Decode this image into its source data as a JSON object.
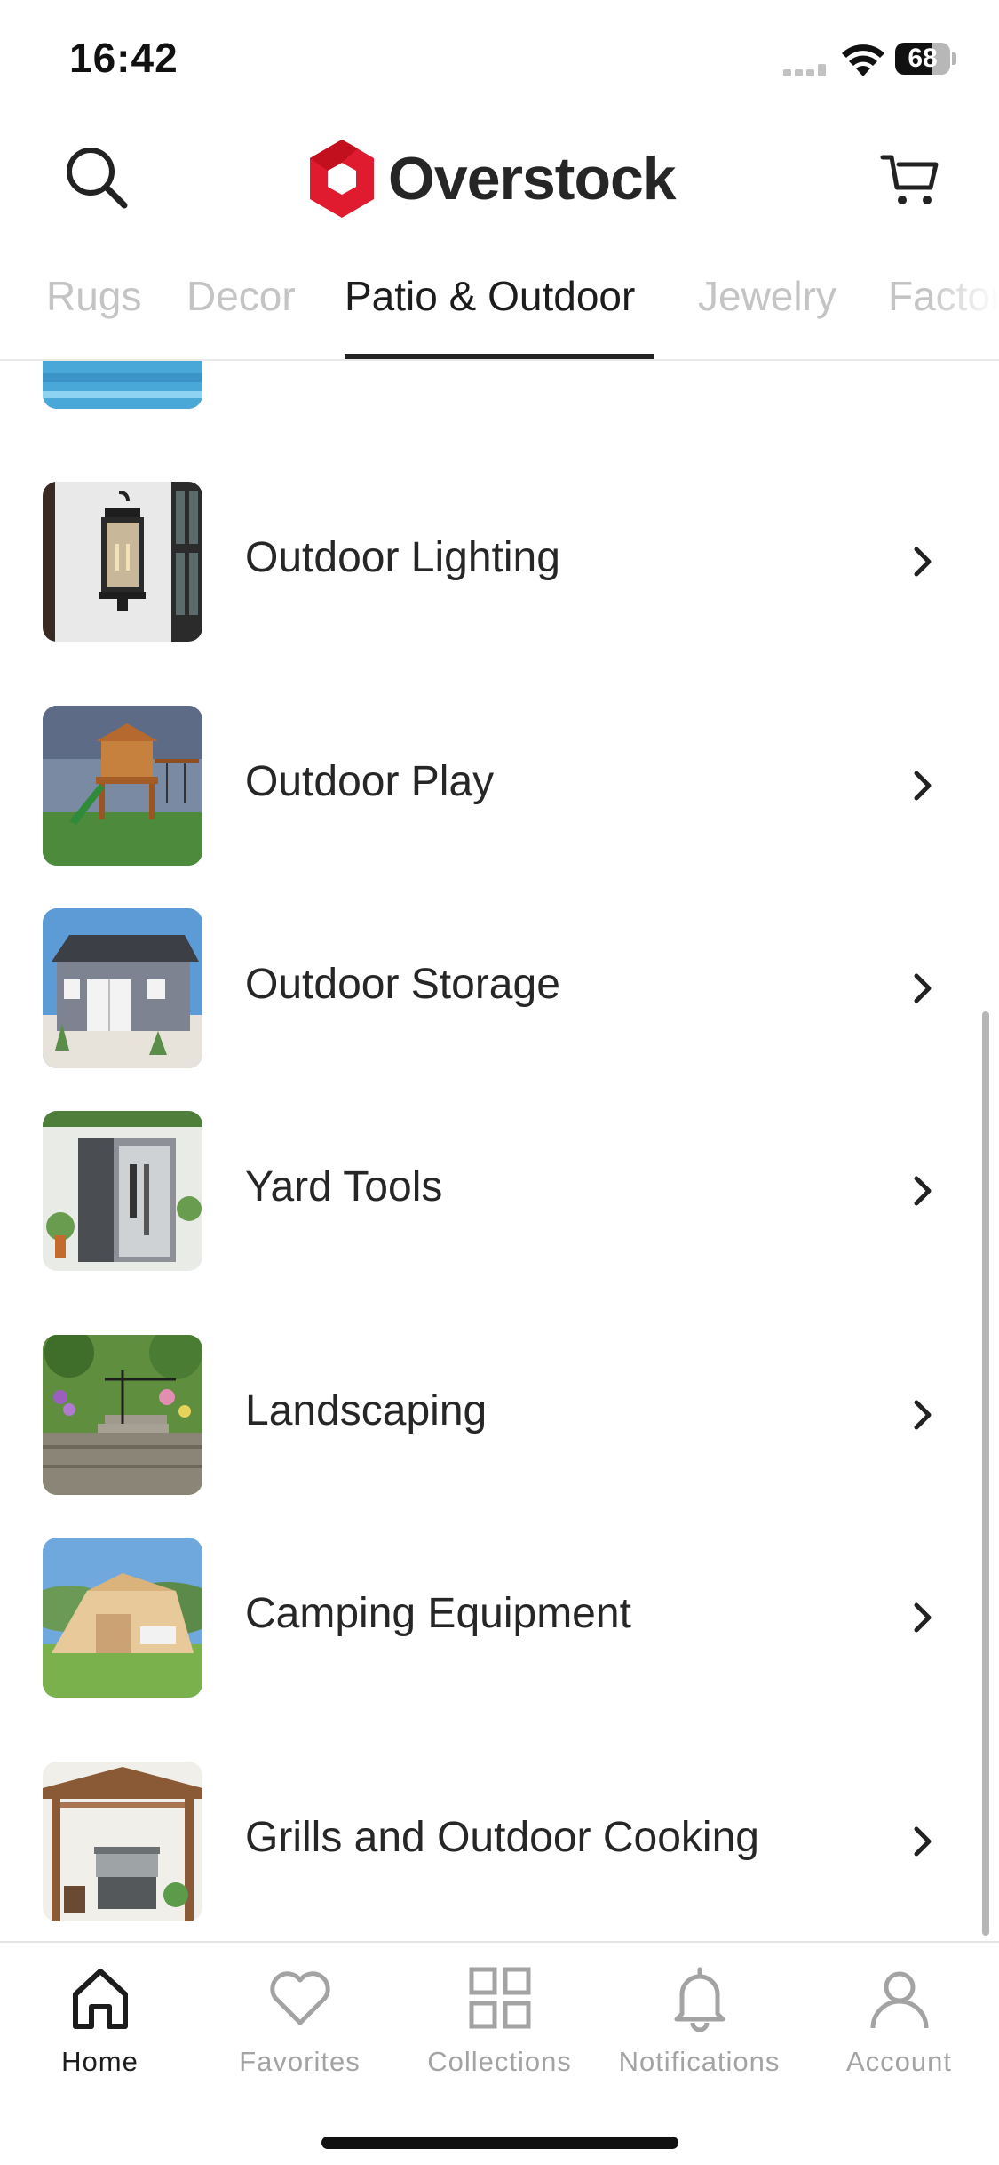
{
  "status_bar": {
    "time": "16:42",
    "battery_level": "68",
    "battery_fraction": 0.68,
    "icons": [
      "cellular-signal-icon",
      "wifi-icon",
      "battery-icon"
    ]
  },
  "header": {
    "brand": "Overstock",
    "brand_color": "#e01b2f",
    "icons": [
      "search-icon",
      "overstock-logo-icon",
      "cart-icon"
    ]
  },
  "tabs": [
    {
      "label": "Rugs",
      "active": false
    },
    {
      "label": "Decor",
      "active": false
    },
    {
      "label": "Patio & Outdoor",
      "active": true
    },
    {
      "label": "Jewelry",
      "active": false
    },
    {
      "label": "Factory",
      "active": false
    }
  ],
  "categories": [
    {
      "label": "",
      "thumbnail": "pool-photo"
    },
    {
      "label": "Outdoor Lighting",
      "thumbnail": "wall-lantern-photo"
    },
    {
      "label": "Outdoor Play",
      "thumbnail": "playset-photo"
    },
    {
      "label": "Outdoor Storage",
      "thumbnail": "storage-shed-photo"
    },
    {
      "label": "Yard Tools",
      "thumbnail": "tool-shed-photo"
    },
    {
      "label": "Landscaping",
      "thumbnail": "garden-steps-photo"
    },
    {
      "label": "Camping Equipment",
      "thumbnail": "tent-photo"
    },
    {
      "label": "Grills and Outdoor Cooking",
      "thumbnail": "pergola-grill-photo"
    }
  ],
  "bottom_nav": [
    {
      "label": "Home",
      "icon": "home-icon",
      "active": true
    },
    {
      "label": "Favorites",
      "icon": "heart-icon",
      "active": false
    },
    {
      "label": "Collections",
      "icon": "grid-icon",
      "active": false
    },
    {
      "label": "Notifications",
      "icon": "bell-icon",
      "active": false
    },
    {
      "label": "Account",
      "icon": "person-icon",
      "active": false
    }
  ]
}
